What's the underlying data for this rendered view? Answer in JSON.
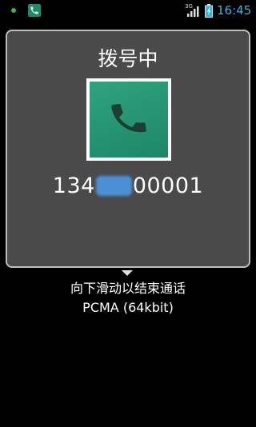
{
  "status_bar": {
    "network_type": "3G",
    "time": "16:45",
    "icons": [
      "notification-dot-icon",
      "call-notification-icon",
      "signal-icon",
      "battery-icon"
    ],
    "time_color": "#33b5e5"
  },
  "call": {
    "status": "拨号中",
    "number_prefix": "134",
    "number_suffix": "00001",
    "photo_icon": "phone-handset-icon",
    "photo_color": "#1d8765"
  },
  "hint": "向下滑动以结束通话",
  "codec": "PCMA (64kbit)"
}
